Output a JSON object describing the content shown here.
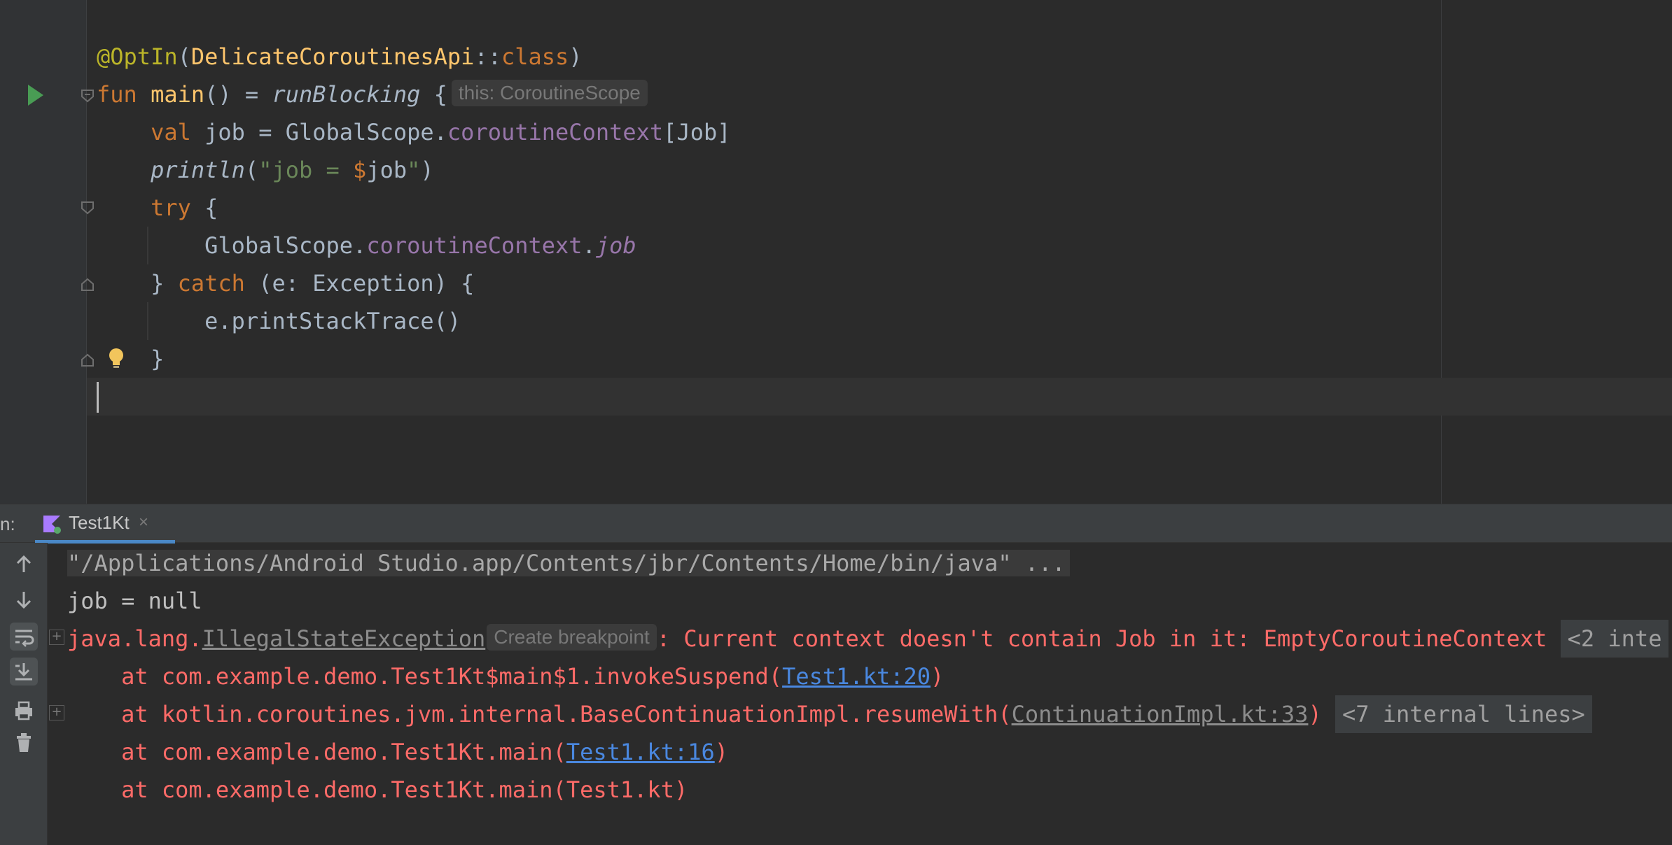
{
  "editor": {
    "line1": {
      "annotation": "@OptIn",
      "open": "(",
      "arg": "DelicateCoroutinesApi",
      "sep": "::",
      "kw": "class",
      "close": ")"
    },
    "line2": {
      "kw": "fun",
      "name": "main",
      "rest": "() = ",
      "call": "runBlocking",
      "brace": " {",
      "hint": "this: CoroutineScope"
    },
    "line3": {
      "kw": "val",
      "rest": " job = GlobalScope.",
      "prop": "coroutineContext",
      "tail": "[Job]"
    },
    "line4": {
      "call": "println",
      "open": "(",
      "str1": "\"job = ",
      "dollar": "$",
      "var": "job",
      "str2": "\"",
      "close": ")"
    },
    "line5": {
      "kw": "try",
      "rest": " {"
    },
    "line6": {
      "obj": "GlobalScope.",
      "prop": "coroutineContext",
      "dot": ".",
      "ext": "job"
    },
    "line7": {
      "brace": "} ",
      "kw": "catch",
      "rest": " (e: Exception) {"
    },
    "line8": {
      "text": "e.printStackTrace()"
    },
    "line9": {
      "text": "}"
    }
  },
  "run_window": {
    "label": "n:",
    "tab_label": "Test1Kt",
    "tab_close": "×"
  },
  "console": {
    "cmd": "\"/Applications/Android Studio.app/Contents/jbr/Contents/Home/bin/java\" ...",
    "out1": "job = null",
    "exc_prefix": "java.lang.",
    "exc_class": "IllegalStateException",
    "create_breakpoint": "Create breakpoint",
    "exc_msg": ": Current context doesn't contain Job in it: EmptyCoroutineContext",
    "exc_collapsed": "<2 inte",
    "trace1_pre": "    at com.example.demo.Test1Kt$main$1.invokeSuspend(",
    "trace1_link": "Test1.kt:20",
    "trace1_post": ")",
    "trace2_pre": "    at kotlin.coroutines.jvm.internal.BaseContinuationImpl.resumeWith(",
    "trace2_link": "ContinuationImpl.kt:33",
    "trace2_post": ")",
    "trace2_collapsed": "<7 internal lines>",
    "trace3_pre": "    at com.example.demo.Test1Kt.main(",
    "trace3_link": "Test1.kt:16",
    "trace3_post": ")",
    "trace4": "    at com.example.demo.Test1Kt.main(Test1.kt)"
  },
  "icons": {
    "run": "run-gutter-icon",
    "bulb": "intention-bulb-icon",
    "kotlin": "kotlin-run-config-icon",
    "up": "up-stack-frame-icon",
    "down": "down-stack-frame-icon",
    "wrap": "soft-wrap-icon",
    "scroll": "scroll-to-end-icon",
    "print": "print-icon",
    "trash": "clear-all-icon"
  },
  "colors": {
    "editor_bg": "#2b2b2b",
    "keyword": "#cc7832",
    "function": "#ffc66d",
    "property": "#9876aa",
    "string": "#6a8759",
    "error": "#ff6b68",
    "link": "#4a88e0"
  }
}
